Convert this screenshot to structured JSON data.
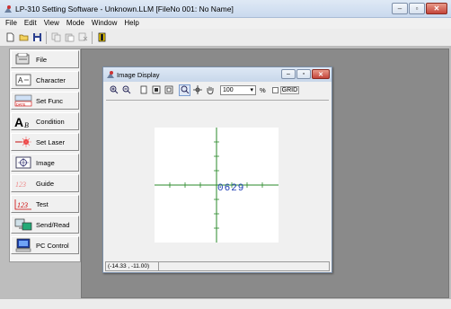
{
  "window": {
    "title": "LP-310 Setting Software - Unknown.LLM  [FileNo 001: No Name]"
  },
  "menu": [
    "File",
    "Edit",
    "View",
    "Mode",
    "Window",
    "Help"
  ],
  "toolbar": {
    "icons": [
      "new-icon",
      "open-icon",
      "save-icon",
      "copy-icon",
      "paste-icon",
      "cut-icon",
      "stop-icon"
    ]
  },
  "sidebar": {
    "items": [
      {
        "label": "File",
        "icon": "file-icon"
      },
      {
        "label": "Character",
        "icon": "character-icon"
      },
      {
        "label": "Set Func",
        "icon": "date-icon"
      },
      {
        "label": "Condition",
        "icon": "condition-icon"
      },
      {
        "label": "Set Laser",
        "icon": "laser-icon"
      },
      {
        "label": "Image",
        "icon": "image-icon"
      },
      {
        "label": "Guide",
        "icon": "guide-icon"
      },
      {
        "label": "Test",
        "icon": "test-icon"
      },
      {
        "label": "Send/Read",
        "icon": "send-read-icon"
      },
      {
        "label": "PC Control",
        "icon": "pc-icon"
      }
    ]
  },
  "image_display": {
    "title": "Image Display",
    "zoom_value": "100",
    "percent": "%",
    "grid_label": "GRID",
    "plot_text": "0629",
    "status_coords": "(-14.33 , -11.00)"
  }
}
